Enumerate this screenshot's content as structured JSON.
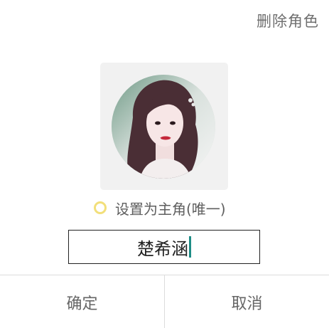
{
  "dialog": {
    "delete_role_label": "删除角色",
    "avatar": {
      "description": "avatar photo of role"
    },
    "main_role_option": {
      "label": "设置为主角(唯一)",
      "checked": false,
      "radio_color": "#f2df7a"
    },
    "name_input": {
      "value": "楚希涵"
    },
    "buttons": {
      "confirm_label": "确定",
      "cancel_label": "取消"
    }
  }
}
